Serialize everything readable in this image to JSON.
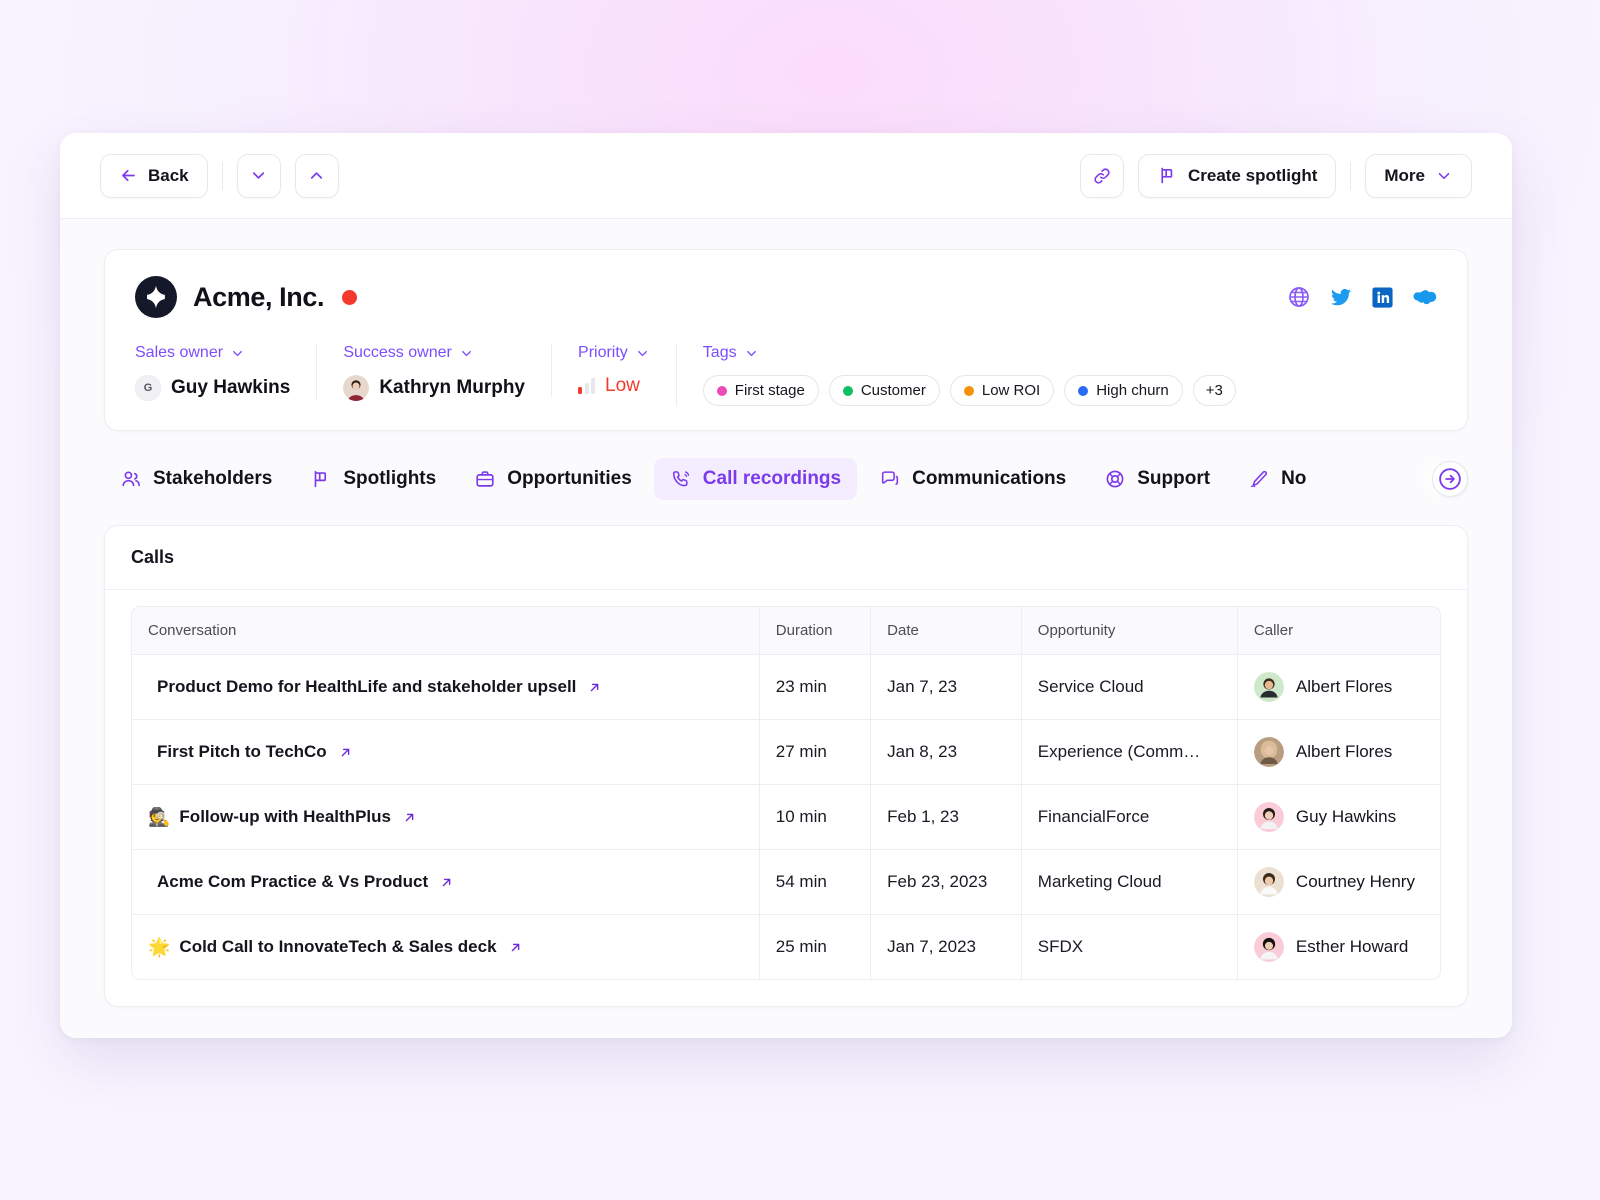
{
  "toolbar": {
    "back_label": "Back",
    "down_icon": "chevron-down-icon",
    "up_icon": "chevron-up-icon",
    "link_icon": "link-icon",
    "create_spotlight_label": "Create spotlight",
    "more_label": "More"
  },
  "account": {
    "name": "Acme, Inc.",
    "status_color": "#f5392c",
    "logo_icon": "sparkle-logo-icon",
    "socials": [
      {
        "name": "globe-icon",
        "color": "#8b5cf6"
      },
      {
        "name": "twitter-icon",
        "color": "#1d9bf0"
      },
      {
        "name": "linkedin-icon",
        "color": "#0a66c2"
      },
      {
        "name": "salesforce-icon",
        "color": "#1798ec"
      }
    ]
  },
  "meta": {
    "sales_owner": {
      "label": "Sales owner",
      "value": "Guy Hawkins",
      "initial": "G"
    },
    "success_owner": {
      "label": "Success owner",
      "value": "Kathryn Murphy"
    },
    "priority": {
      "label": "Priority",
      "value": "Low",
      "color": "#f5392c"
    },
    "tags": {
      "label": "Tags",
      "items": [
        {
          "label": "First stage",
          "color": "#ec4ab8"
        },
        {
          "label": "Customer",
          "color": "#0fbf62"
        },
        {
          "label": "Low ROI",
          "color": "#f59009"
        },
        {
          "label": "High churn",
          "color": "#2a6cf6"
        }
      ],
      "overflow": "+3"
    }
  },
  "tabs": [
    {
      "label": "Stakeholders",
      "icon": "people-icon",
      "active": false
    },
    {
      "label": "Spotlights",
      "icon": "megaphone-icon",
      "active": false
    },
    {
      "label": "Opportunities",
      "icon": "briefcase-icon",
      "active": false
    },
    {
      "label": "Call recordings",
      "icon": "phone-icon",
      "active": true
    },
    {
      "label": "Communications",
      "icon": "chat-icon",
      "active": false
    },
    {
      "label": "Support",
      "icon": "lifebuoy-icon",
      "active": false
    },
    {
      "label": "No",
      "icon": "pencil-icon",
      "active": false
    }
  ],
  "tabs_scroll_icon": "arrow-right-circle-icon",
  "calls": {
    "title": "Calls",
    "columns": [
      "Conversation",
      "Duration",
      "Date",
      "Opportunity",
      "Caller"
    ],
    "rows": [
      {
        "emoji": "",
        "conversation": "Product Demo for HealthLife and stakeholder upsell",
        "duration": "23 min",
        "date": "Jan 7, 23",
        "opportunity": "Service Cloud",
        "caller": "Albert Flores",
        "avatar_color": "#cde8cb"
      },
      {
        "emoji": "",
        "conversation": "First Pitch to TechCo",
        "duration": "27 min",
        "date": "Jan 8, 23",
        "opportunity": "Experience (Comm…",
        "caller": "Albert Flores",
        "avatar_color": "#d6c0a8"
      },
      {
        "emoji": "🕵️",
        "conversation": "Follow-up with HealthPlus",
        "duration": "10 min",
        "date": "Feb 1, 23",
        "opportunity": "FinancialForce",
        "caller": "Guy Hawkins",
        "avatar_color": "#f9ccd8"
      },
      {
        "emoji": "",
        "conversation": "Acme Com Practice & Vs Product",
        "duration": "54 min",
        "date": "Feb 23, 2023",
        "opportunity": "Marketing Cloud",
        "caller": "Courtney Henry",
        "avatar_color": "#ece0d2"
      },
      {
        "emoji": "🌟",
        "conversation": "Cold Call to InnovateTech & Sales deck",
        "duration": "25 min",
        "date": "Jan 7, 2023",
        "opportunity": "SFDX",
        "caller": "Esther Howard",
        "avatar_color": "#f9ccd8"
      }
    ]
  }
}
